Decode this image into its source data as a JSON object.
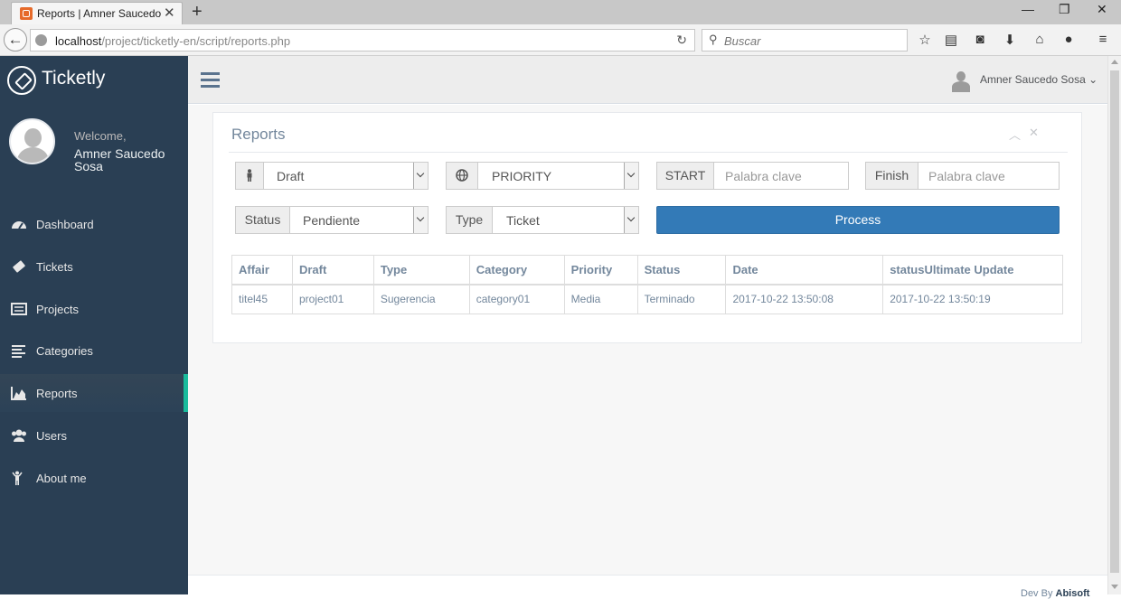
{
  "browser": {
    "tab_title": "Reports | Amner Saucedo ...",
    "tab_close": "✕",
    "new_tab": "+",
    "url_host": "localhost",
    "url_path": "/project/ticketly-en/script/reports.php",
    "search_placeholder": "Buscar",
    "window_controls": [
      "—",
      "❐",
      "✕"
    ]
  },
  "sidebar": {
    "brand": "Ticketly",
    "welcome": "Welcome,",
    "user_name": "Amner Saucedo Sosa",
    "items": [
      {
        "label": "Dashboard",
        "icon": "dashboard-icon"
      },
      {
        "label": "Tickets",
        "icon": "ticket-icon"
      },
      {
        "label": "Projects",
        "icon": "list-alt-icon"
      },
      {
        "label": "Categories",
        "icon": "align-left-icon"
      },
      {
        "label": "Reports",
        "icon": "area-chart-icon",
        "active": true
      },
      {
        "label": "Users",
        "icon": "users-icon"
      },
      {
        "label": "About me",
        "icon": "child-icon"
      }
    ]
  },
  "topnav": {
    "user_name": "Amner Saucedo Sosa",
    "caret": "⌄"
  },
  "panel": {
    "title": "Reports",
    "filters": {
      "project_value": "Draft",
      "priority_value": "PRIORITY",
      "start_label": "START",
      "start_placeholder": "Palabra clave",
      "finish_label": "Finish",
      "finish_placeholder": "Palabra clave",
      "status_label": "Status",
      "status_value": "Pendiente",
      "type_label": "Type",
      "type_value": "Ticket",
      "process_label": "Process"
    },
    "table": {
      "headers": [
        "Affair",
        "Draft",
        "Type",
        "Category",
        "Priority",
        "Status",
        "Date",
        "statusUltimate Update"
      ],
      "rows": [
        [
          "titel45",
          "project01",
          "Sugerencia",
          "category01",
          "Media",
          "Terminado",
          "2017-10-22 13:50:08",
          "2017-10-22 13:50:19"
        ]
      ]
    }
  },
  "footer": {
    "prefix": "Dev By ",
    "author": "Abisoft"
  },
  "colors": {
    "sidebar_bg": "#2a3f54",
    "active_accent": "#1abb9c",
    "process_button": "#337ab7",
    "text_muted": "#73879c"
  }
}
